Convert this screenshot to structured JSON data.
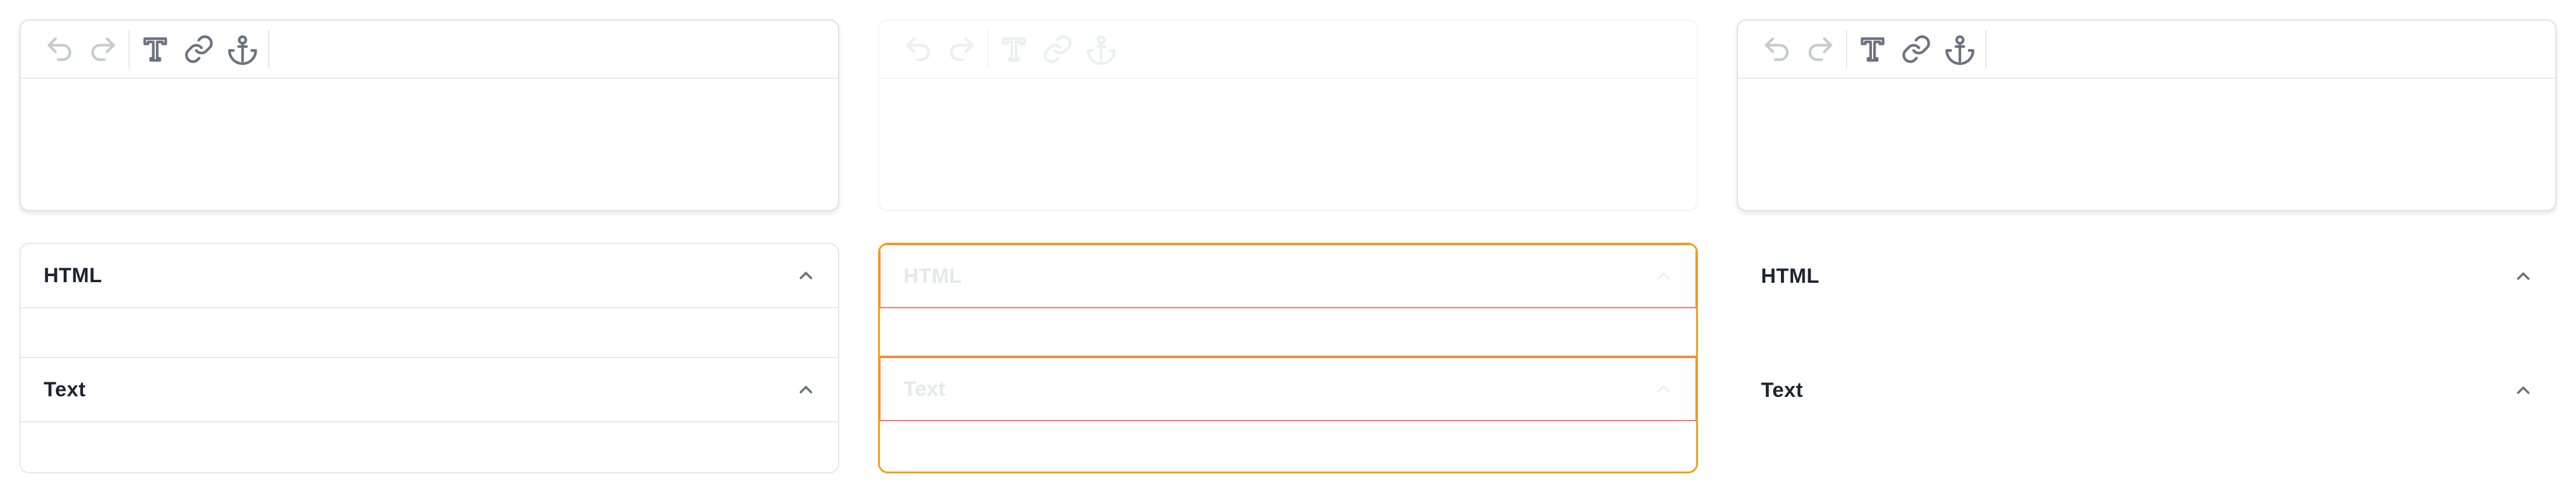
{
  "toolbar": {
    "tools": [
      {
        "icon": "undo-icon"
      },
      {
        "icon": "redo-icon"
      },
      {
        "icon": "text-format-icon"
      },
      {
        "icon": "link-icon"
      },
      {
        "icon": "anchor-icon"
      }
    ]
  },
  "sections": {
    "html_label": "HTML",
    "text_label": "Text",
    "chevron_icon": "chevron-up-icon"
  },
  "colors": {
    "border": "#e5e7eb",
    "invalid_outer": "#f59e0b",
    "invalid_inner": "#f87171",
    "heading_text": "#1e2433",
    "icon_active": "#6b7280",
    "icon_muted": "#c7cad1"
  }
}
